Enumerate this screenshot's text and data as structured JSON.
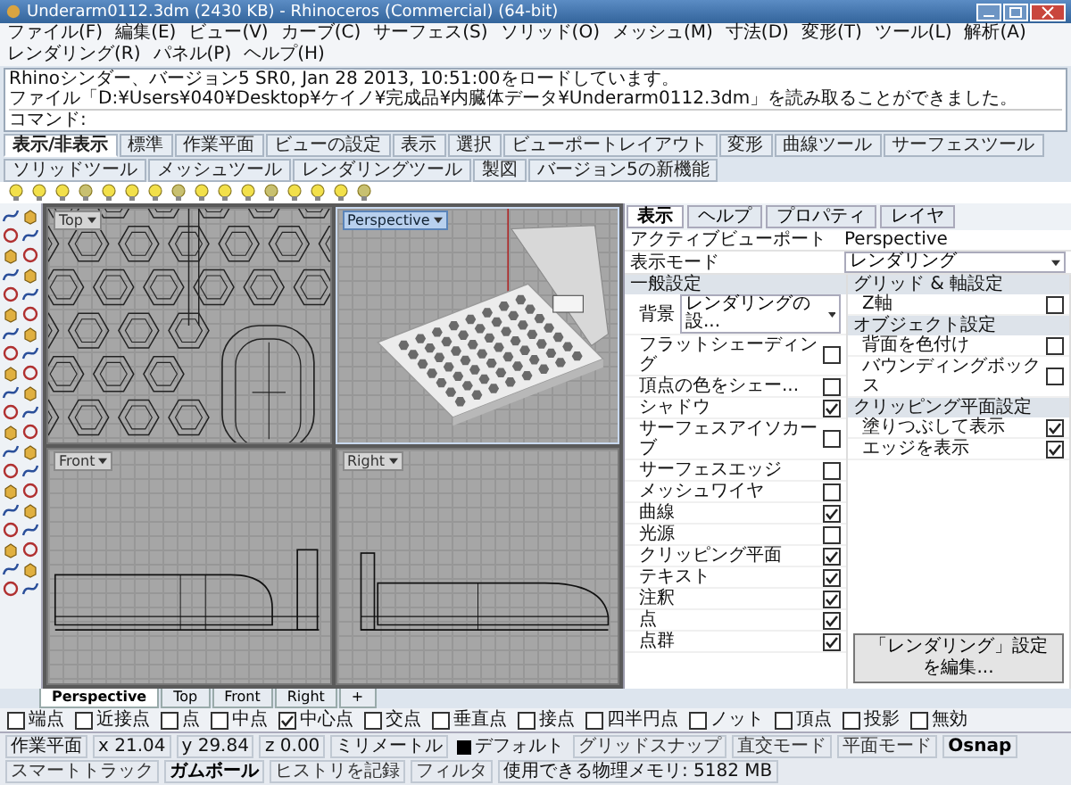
{
  "window": {
    "title": "Underarm0112.3dm (2430 KB) - Rhinoceros (Commercial) (64-bit)"
  },
  "menu": [
    "ファイル(F)",
    "編集(E)",
    "ビュー(V)",
    "カーブ(C)",
    "サーフェス(S)",
    "ソリッド(O)",
    "メッシュ(M)",
    "寸法(D)",
    "変形(T)",
    "ツール(L)",
    "解析(A)",
    "レンダリング(R)",
    "パネル(P)",
    "ヘルプ(H)"
  ],
  "command_history": [
    "Rhinoシンダー、バージョン5 SR0, Jan 28 2013, 10:51:00をロードしています。",
    "ファイル「D:¥Users¥040¥Desktop¥ケイノ¥完成品¥内臓体データ¥Underarm0112.3dm」を読み取ることができました。"
  ],
  "command_prompt": "コマンド:",
  "toolbar_tabs": [
    {
      "label": "表示/非表示",
      "selected": true
    },
    {
      "label": "標準",
      "selected": false
    },
    {
      "label": "作業平面",
      "selected": false
    },
    {
      "label": "ビューの設定",
      "selected": false
    },
    {
      "label": "表示",
      "selected": false
    },
    {
      "label": "選択",
      "selected": false
    },
    {
      "label": "ビューポートレイアウト",
      "selected": false
    },
    {
      "label": "変形",
      "selected": false
    },
    {
      "label": "曲線ツール",
      "selected": false
    },
    {
      "label": "サーフェスツール",
      "selected": false
    },
    {
      "label": "ソリッドツール",
      "selected": false
    },
    {
      "label": "メッシュツール",
      "selected": false
    },
    {
      "label": "レンダリングツール",
      "selected": false
    },
    {
      "label": "製図",
      "selected": false
    },
    {
      "label": "バージョン5の新機能",
      "selected": false
    }
  ],
  "viewports": [
    {
      "label": "Top",
      "kind": "top",
      "active": false
    },
    {
      "label": "Perspective",
      "kind": "perspective",
      "active": true
    },
    {
      "label": "Front",
      "kind": "front",
      "active": false
    },
    {
      "label": "Right",
      "kind": "right",
      "active": false
    }
  ],
  "view_tabs": [
    {
      "label": "Perspective",
      "selected": true
    },
    {
      "label": "Top",
      "selected": false
    },
    {
      "label": "Front",
      "selected": false
    },
    {
      "label": "Right",
      "selected": false
    },
    {
      "label": "+",
      "selected": false
    }
  ],
  "osnaps": [
    {
      "label": "端点",
      "checked": false
    },
    {
      "label": "近接点",
      "checked": false
    },
    {
      "label": "点",
      "checked": false
    },
    {
      "label": "中点",
      "checked": false
    },
    {
      "label": "中心点",
      "checked": true
    },
    {
      "label": "交点",
      "checked": false
    },
    {
      "label": "垂直点",
      "checked": false
    },
    {
      "label": "接点",
      "checked": false
    },
    {
      "label": "四半円点",
      "checked": false
    },
    {
      "label": "ノット",
      "checked": false
    },
    {
      "label": "頂点",
      "checked": false
    },
    {
      "label": "投影",
      "checked": false
    },
    {
      "label": "無効",
      "checked": false
    }
  ],
  "status_bar": {
    "plane": "作業平面",
    "x": "x 21.04",
    "y": "y 29.84",
    "z": "z 0.00",
    "units": "ミリメートル",
    "layer": "デフォルト",
    "toggles": [
      {
        "label": "グリッドスナップ",
        "on": false
      },
      {
        "label": "直交モード",
        "on": false
      },
      {
        "label": "平面モード",
        "on": false
      },
      {
        "label": "Osnap",
        "on": true
      },
      {
        "label": "スマートトラック",
        "on": false
      },
      {
        "label": "ガムボール",
        "on": true
      },
      {
        "label": "ヒストリを記録",
        "on": false
      },
      {
        "label": "フィルタ",
        "on": false
      }
    ],
    "memory": "使用できる物理メモリ: 5182 MB"
  },
  "panel": {
    "tabs": [
      {
        "label": "表示",
        "selected": true
      },
      {
        "label": "ヘルプ",
        "selected": false
      },
      {
        "label": "プロパティ",
        "selected": false
      },
      {
        "label": "レイヤ",
        "selected": false
      }
    ],
    "active_viewport": {
      "label": "アクティブビューポート",
      "value": "Perspective"
    },
    "display_mode": {
      "label": "表示モード",
      "value": "レンダリング"
    },
    "sections": [
      {
        "title": "一般設定",
        "rows": [
          {
            "kind": "dropdown",
            "label": "背景",
            "value": "レンダリングの設..."
          },
          {
            "kind": "checkbox",
            "label": "フラットシェーディング",
            "checked": false
          },
          {
            "kind": "checkbox",
            "label": "頂点の色をシェー...",
            "checked": false
          },
          {
            "kind": "checkbox",
            "label": "シャドウ",
            "checked": true
          },
          {
            "kind": "checkbox",
            "label": "サーフェスアイソカーブ",
            "checked": false
          },
          {
            "kind": "checkbox",
            "label": "サーフェスエッジ",
            "checked": false
          },
          {
            "kind": "checkbox",
            "label": "メッシュワイヤ",
            "checked": false
          },
          {
            "kind": "checkbox",
            "label": "曲線",
            "checked": true
          },
          {
            "kind": "checkbox",
            "label": "光源",
            "checked": false
          },
          {
            "kind": "checkbox",
            "label": "クリッピング平面",
            "checked": true
          },
          {
            "kind": "checkbox",
            "label": "テキスト",
            "checked": true
          },
          {
            "kind": "checkbox",
            "label": "注釈",
            "checked": true
          },
          {
            "kind": "checkbox",
            "label": "点",
            "checked": true
          },
          {
            "kind": "checkbox",
            "label": "点群",
            "checked": true
          }
        ]
      },
      {
        "title": "グリッド & 軸設定",
        "rows": [
          {
            "kind": "checkbox",
            "label": "Z軸",
            "checked": false
          }
        ]
      },
      {
        "title": "オブジェクト設定",
        "rows": [
          {
            "kind": "checkbox",
            "label": "背面を色付け",
            "checked": false
          },
          {
            "kind": "checkbox",
            "label": "バウンディングボックス",
            "checked": false
          }
        ]
      },
      {
        "title": "クリッピング平面設定",
        "rows": [
          {
            "kind": "checkbox",
            "label": "塗りつぶして表示",
            "checked": true
          },
          {
            "kind": "checkbox",
            "label": "エッジを表示",
            "checked": true
          }
        ]
      }
    ],
    "button": "「レンダリング」設定を編集..."
  }
}
